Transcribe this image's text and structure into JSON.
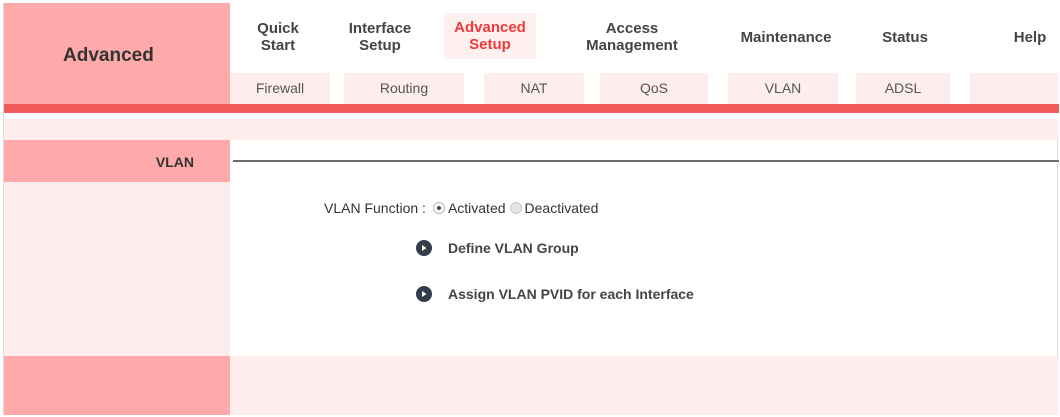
{
  "brand": {
    "title": "Advanced"
  },
  "menu": [
    {
      "label": "Quick\nStart"
    },
    {
      "label": "Interface\nSetup"
    },
    {
      "label": "Advanced\nSetup"
    },
    {
      "label": "Access\nManagement"
    },
    {
      "label": "Maintenance"
    },
    {
      "label": "Status"
    },
    {
      "label": "Help"
    }
  ],
  "submenu": [
    {
      "label": "Firewall"
    },
    {
      "label": "Routing"
    },
    {
      "label": "NAT"
    },
    {
      "label": "QoS"
    },
    {
      "label": "VLAN"
    },
    {
      "label": "ADSL"
    }
  ],
  "section": {
    "title": "VLAN"
  },
  "vlan_function": {
    "label": "VLAN Function :",
    "options": [
      "Activated",
      "Deactivated"
    ],
    "selected": "Activated"
  },
  "links": [
    {
      "label": "Define VLAN Group"
    },
    {
      "label": "Assign VLAN PVID for each Interface"
    }
  ],
  "colors": {
    "accent": "#ef3a3a",
    "sidebar": "#ffaaaa",
    "band": "#fdeded",
    "redbar": "#f05a5a"
  }
}
